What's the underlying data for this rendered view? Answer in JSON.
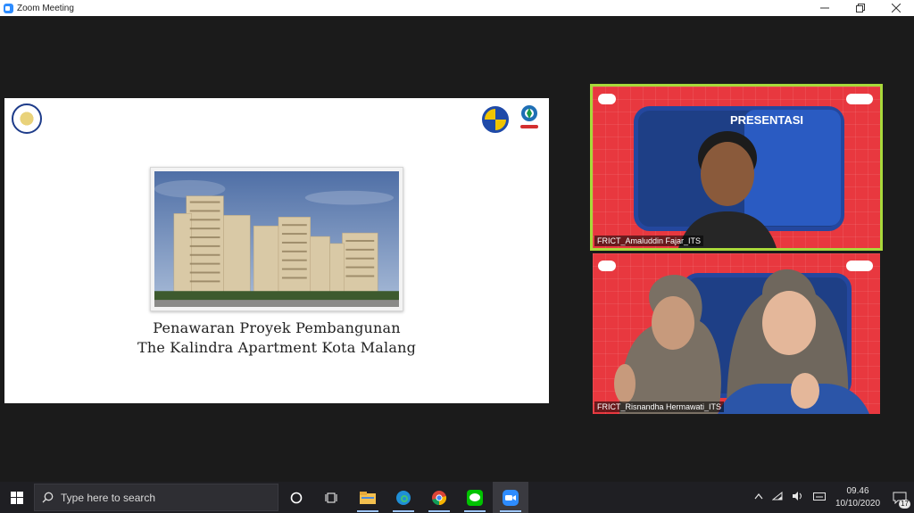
{
  "window": {
    "title": "Zoom Meeting",
    "minimize_icon": "minimize-icon",
    "maximize_icon": "restore-icon",
    "close_icon": "close-icon"
  },
  "slide": {
    "line1": "Penawaran Proyek Pembangunan",
    "line2": "The Kalindra Apartment Kota Malang"
  },
  "participants": [
    {
      "name": "FRICT_Amaluddin Fajar_ITS",
      "active_speaker": true,
      "background_title": "PRESENTASI"
    },
    {
      "name": "FRICT_Risnandha Hermawati_ITS",
      "active_speaker": false
    }
  ],
  "taskbar": {
    "search_placeholder": "Type here to search",
    "time": "09.46",
    "date": "10/10/2020",
    "notification_count": "17",
    "apps": [
      "task-view",
      "file-explorer",
      "edge",
      "chrome",
      "line",
      "zoom"
    ]
  },
  "colors": {
    "accent_active_speaker": "#a9d93a",
    "zoom_blue": "#2d8cff",
    "tile_background": "#e8383f"
  }
}
